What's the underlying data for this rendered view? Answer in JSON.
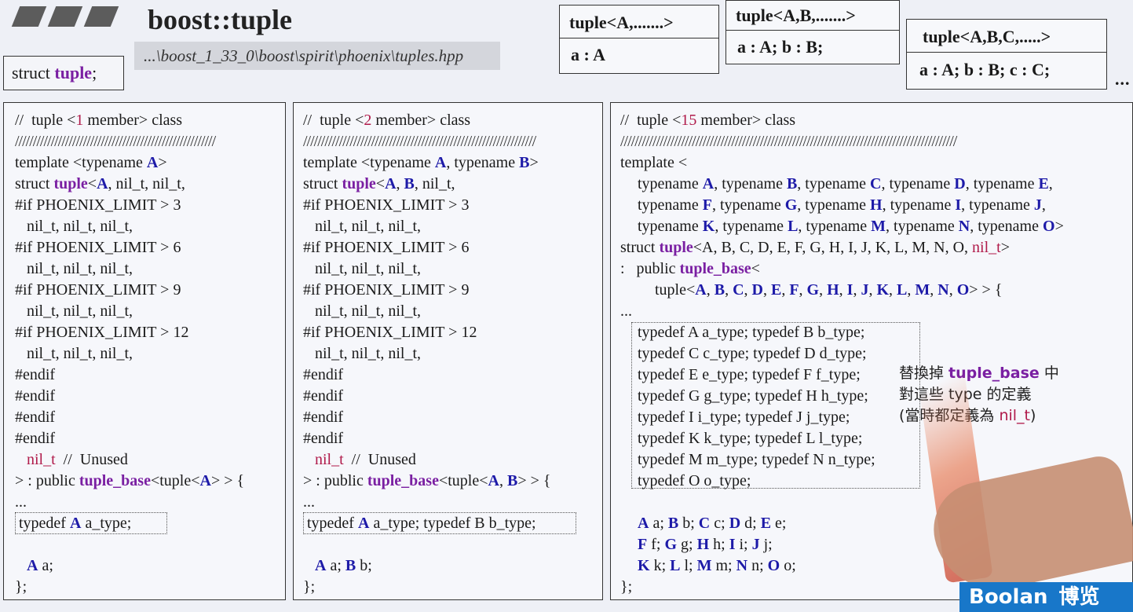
{
  "header": {
    "title": "boost::tuple",
    "path": "...\\boost_1_33_0\\boost\\spirit\\phoenix\\tuples.hpp",
    "struct_prefix": "struct ",
    "struct_name": "tuple",
    "struct_suffix": ";"
  },
  "tuple_boxes": [
    {
      "head": "tuple<A,.......>",
      "body": "a : A"
    },
    {
      "head": "tuple<A,B,.......>",
      "body": "a : A; b : B;"
    },
    {
      "head": "tuple<A,B,C,.....>",
      "body": "a : A; b : B; c : C;"
    }
  ],
  "tuple_more": "...",
  "panel1": {
    "comment_pre": "//  tuple <",
    "comment_num": "1",
    "comment_post": " member> class",
    "hash_line": "////////////////////////////////////////////////////////",
    "tpl_pre": "template <typename ",
    "tpl_arg": "A",
    "tpl_post": ">",
    "struct_pre": "struct ",
    "struct_kw": "tuple",
    "struct_post1": "<",
    "struct_arg": "A",
    "struct_post2": ", nil_t, nil_t,",
    "if3": "#if PHOENIX_LIMIT > 3",
    "nil3": "   nil_t, nil_t, nil_t,",
    "if6": "#if PHOENIX_LIMIT > 6",
    "nil6": "   nil_t, nil_t, nil_t,",
    "if9": "#if PHOENIX_LIMIT > 9",
    "nil9": "   nil_t, nil_t, nil_t,",
    "if12": "#if PHOENIX_LIMIT > 12",
    "nil12": "   nil_t, nil_t, nil_t,",
    "endif": "#endif",
    "unused_nil": "nil_t",
    "unused_cmt": "  //  Unused",
    "base_pre": "> : public ",
    "base_kw": "tuple_base",
    "base_mid": "<tuple<",
    "base_arg": "A",
    "base_post": "> > {",
    "dots": "...",
    "typedef_pre": "typedef ",
    "typedef_arg": "A",
    "typedef_post": " a_type;",
    "member_arg": "A",
    "member_post": " a;",
    "close": "};"
  },
  "panel2": {
    "comment_pre": "//  tuple <",
    "comment_num": "2",
    "comment_post": " member> class",
    "hash_line": "/////////////////////////////////////////////////////////////////",
    "tpl_pre": "template <typename ",
    "tpl_a": "A",
    "tpl_mid": ", typename ",
    "tpl_b": "B",
    "tpl_post": ">",
    "struct_pre": "struct ",
    "struct_kw": "tuple",
    "struct_lt": "<",
    "struct_a": "A",
    "struct_comma": ", ",
    "struct_b": "B",
    "struct_post": ", nil_t,",
    "if3": "#if PHOENIX_LIMIT > 3",
    "nil3": "   nil_t, nil_t, nil_t,",
    "if6": "#if PHOENIX_LIMIT > 6",
    "nil6": "   nil_t, nil_t, nil_t,",
    "if9": "#if PHOENIX_LIMIT > 9",
    "nil9": "   nil_t, nil_t, nil_t,",
    "if12": "#if PHOENIX_LIMIT > 12",
    "nil12": "   nil_t, nil_t, nil_t,",
    "endif": "#endif",
    "unused_nil": "nil_t",
    "unused_cmt": "  //  Unused",
    "base_pre": "> : public ",
    "base_kw": "tuple_base",
    "base_mid": "<tuple<",
    "base_a": "A",
    "base_comma": ", ",
    "base_b": "B",
    "base_post": "> > {",
    "dots": "...",
    "typedef_pre": "typedef ",
    "typedef_a": "A",
    "typedef_post": " a_type; typedef B b_type;",
    "member_a": "A",
    "member_mid": " a; ",
    "member_b": "B",
    "member_post": " b;",
    "close": "};"
  },
  "panel3": {
    "comment_pre": "//  tuple <",
    "comment_num": "15",
    "comment_post": " member> class",
    "hash_line": "//////////////////////////////////////////////////////////////////////////////////////////////",
    "tpl_open": "template <",
    "tn_line1": [
      [
        "typename ",
        "A",
        ", "
      ],
      [
        "typename ",
        "B",
        ", "
      ],
      [
        "typename ",
        "C",
        ", "
      ],
      [
        "typename ",
        "D",
        ", "
      ],
      [
        "typename ",
        "E",
        ","
      ]
    ],
    "tn_line2": [
      [
        "typename ",
        "F",
        ", "
      ],
      [
        "typename ",
        "G",
        ", "
      ],
      [
        "typename ",
        "H",
        ", "
      ],
      [
        "typename ",
        "I",
        ", "
      ],
      [
        "typename ",
        "J",
        ","
      ]
    ],
    "tn_line3": [
      [
        "typename ",
        "K",
        ", "
      ],
      [
        "typename ",
        "L",
        ", "
      ],
      [
        "typename ",
        "M",
        ", "
      ],
      [
        "typename ",
        "N",
        ", "
      ],
      [
        "typename ",
        "O",
        ">"
      ]
    ],
    "struct_pre": "struct ",
    "struct_kw": "tuple",
    "struct_args": "<A, B, C, D, E, F, G, H, I, J, K, L, M, N, O, ",
    "struct_nil": "nil_t",
    "struct_post": ">",
    "public_pre": ":   public ",
    "public_kw": "tuple_base",
    "public_post": "<",
    "base_tuple": "tuple<",
    "base_args": [
      "A",
      "B",
      "C",
      "D",
      "E",
      "F",
      "G",
      "H",
      "I",
      "J",
      "K",
      "L",
      "M",
      "N",
      "O"
    ],
    "base_post": "> > {",
    "dots": "...",
    "typedefs": [
      "typedef A a_type; typedef B b_type;",
      "typedef C c_type; typedef D d_type;",
      "typedef E e_type; typedef F f_type;",
      "typedef G g_type; typedef H h_type;",
      "typedef I i_type; typedef J j_type;",
      "typedef K k_type; typedef L l_type;",
      "typedef M m_type; typedef N n_type;",
      "typedef O o_type;"
    ],
    "members": [
      [
        [
          "A",
          " a; "
        ],
        [
          "B",
          " b; "
        ],
        [
          "C",
          " c; "
        ],
        [
          "D",
          " d; "
        ],
        [
          "E",
          " e;"
        ]
      ],
      [
        [
          "F",
          " f; "
        ],
        [
          "G",
          " g; "
        ],
        [
          "H",
          " h; "
        ],
        [
          "I",
          " i; "
        ],
        [
          "J",
          " j;"
        ]
      ],
      [
        [
          "K",
          " k; "
        ],
        [
          "L",
          " l; "
        ],
        [
          "M",
          " m; "
        ],
        [
          "N",
          " n; "
        ],
        [
          "O",
          " o;"
        ]
      ]
    ],
    "close": "};"
  },
  "note": {
    "line1_pre": "替換掉 ",
    "line1_kw": "tuple_base",
    "line1_post": " 中",
    "line2": "對這些 type 的定義",
    "line3_pre": "(當時都定義為 ",
    "line3_nil": "nil_t",
    "line3_post": ")"
  },
  "brand": {
    "en": "Boolan",
    "zh": "博览"
  },
  "colors": {
    "keyword": "#7a1fa2",
    "typename_arg": "#1d1aa8",
    "nil_red": "#b01a4a",
    "brand_bg": "#1877c9"
  }
}
